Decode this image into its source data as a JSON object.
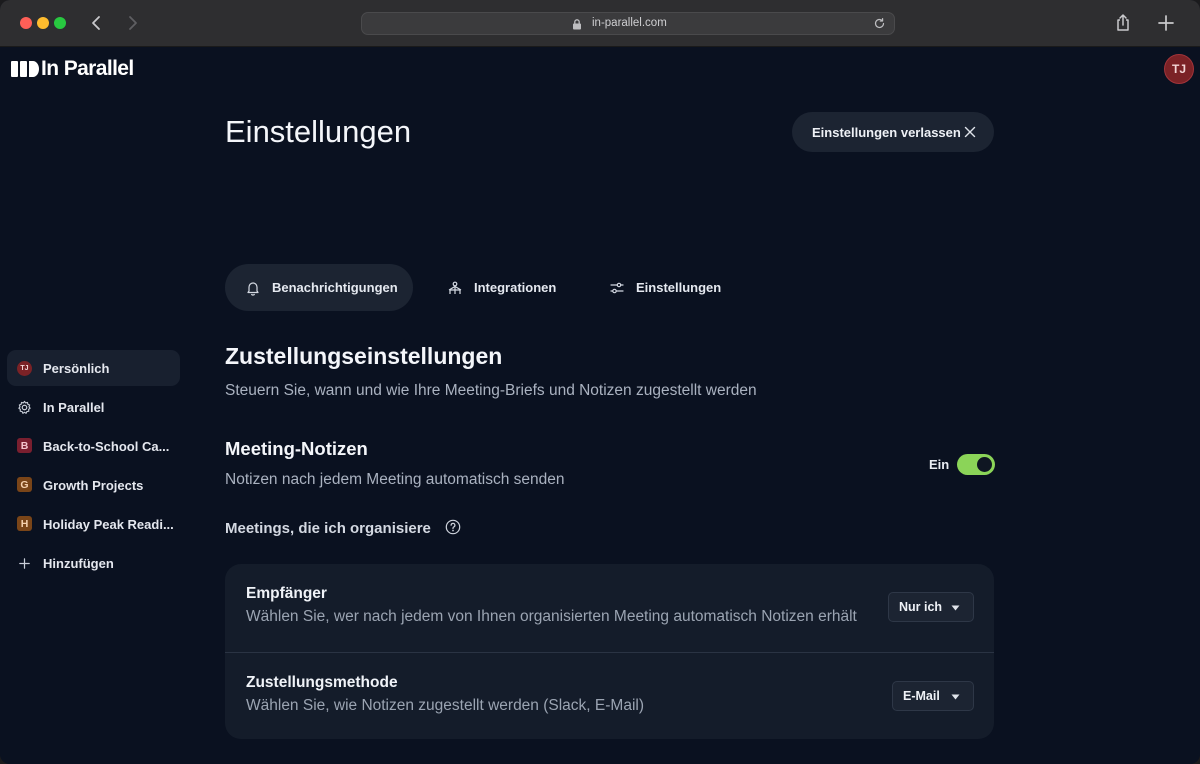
{
  "browser": {
    "url": "in-parallel.com"
  },
  "app": {
    "logo_text": "In Parallel",
    "user_initials": "TJ"
  },
  "sidebar": {
    "items": [
      {
        "label": "Persönlich",
        "badge": "TJ",
        "active": true
      },
      {
        "label": "In Parallel",
        "icon": "gear-icon"
      },
      {
        "label": "Back-to-School Ca...",
        "badge": "B",
        "badge_color": "#c0304a"
      },
      {
        "label": "Growth Projects",
        "badge": "G",
        "badge_color": "#c76a2e"
      },
      {
        "label": "Holiday Peak Readi...",
        "badge": "H",
        "badge_color": "#c76a2e"
      },
      {
        "label": "Hinzufügen",
        "icon": "plus-icon"
      }
    ]
  },
  "header": {
    "title": "Einstellungen",
    "exit_label": "Einstellungen verlassen"
  },
  "tabs": [
    {
      "label": "Benachrichtigungen",
      "icon": "bell-icon",
      "active": true
    },
    {
      "label": "Integrationen",
      "icon": "integrations-icon"
    },
    {
      "label": "Einstellungen",
      "icon": "sliders-icon"
    }
  ],
  "delivery": {
    "title": "Zustellungseinstellungen",
    "subtitle": "Steuern Sie, wann und wie Ihre Meeting-Briefs und Notizen zugestellt werden"
  },
  "meeting_notes": {
    "title": "Meeting-Notizen",
    "subtitle": "Notizen nach jedem Meeting automatisch senden",
    "toggle_label": "Ein",
    "toggle_on": true
  },
  "organized": {
    "title": "Meetings, die ich organisiere"
  },
  "settings_rows": [
    {
      "title": "Empfänger",
      "subtitle": "Wählen Sie, wer nach jedem von Ihnen organisierten Meeting automatisch Notizen erhält",
      "value": "Nur ich"
    },
    {
      "title": "Zustellungsmethode",
      "subtitle": "Wählen Sie, wie Notizen zugestellt werden (Slack, E-Mail)",
      "value": "E-Mail"
    }
  ],
  "colors": {
    "background": "#0a1120",
    "toggle_accent": "#8bd458",
    "avatar": "#7b2226"
  }
}
